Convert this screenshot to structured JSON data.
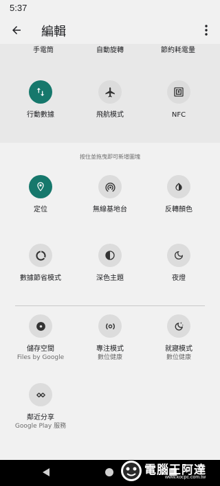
{
  "status_bar": {
    "time": "5:37"
  },
  "app_bar": {
    "title": "編輯"
  },
  "active_tiles_partial": [
    "手電筒",
    "自動旋轉",
    "節約耗電量"
  ],
  "active_tiles": [
    {
      "label": "行動數據",
      "icon": "swap-vertical-icon",
      "active": true
    },
    {
      "label": "飛航模式",
      "icon": "airplane-icon",
      "active": false
    },
    {
      "label": "NFC",
      "icon": "nfc-icon",
      "active": false
    }
  ],
  "hint": "按住並拖曳即可新增圖塊",
  "available_tiles": [
    {
      "label": "定位",
      "icon": "location-icon",
      "active": true
    },
    {
      "label": "無線基地台",
      "icon": "hotspot-icon",
      "active": false
    },
    {
      "label": "反轉顏色",
      "icon": "invert-colors-icon",
      "active": false
    },
    {
      "label": "數據節省模式",
      "icon": "data-saver-icon",
      "active": false
    },
    {
      "label": "深色主題",
      "icon": "dark-theme-icon",
      "active": false
    },
    {
      "label": "夜燈",
      "icon": "night-light-icon",
      "active": false
    }
  ],
  "third_party_tiles": [
    {
      "label": "儲存空間",
      "sub": "Files by Google",
      "icon": "storage-icon"
    },
    {
      "label": "專注模式",
      "sub": "數位健康",
      "icon": "focus-mode-icon"
    },
    {
      "label": "就寢模式",
      "sub": "數位健康",
      "icon": "bedtime-icon"
    },
    {
      "label": "鄰近分享",
      "sub": "Google Play 服務",
      "icon": "nearby-share-icon"
    }
  ],
  "watermark": {
    "text": "電腦王阿達",
    "url": "www.kocpc.com.tw"
  },
  "colors": {
    "accent": "#16786c",
    "tile_bg": "#dcdcdc",
    "background": "#f1f1f1",
    "active_area": "#e8e8e8"
  }
}
